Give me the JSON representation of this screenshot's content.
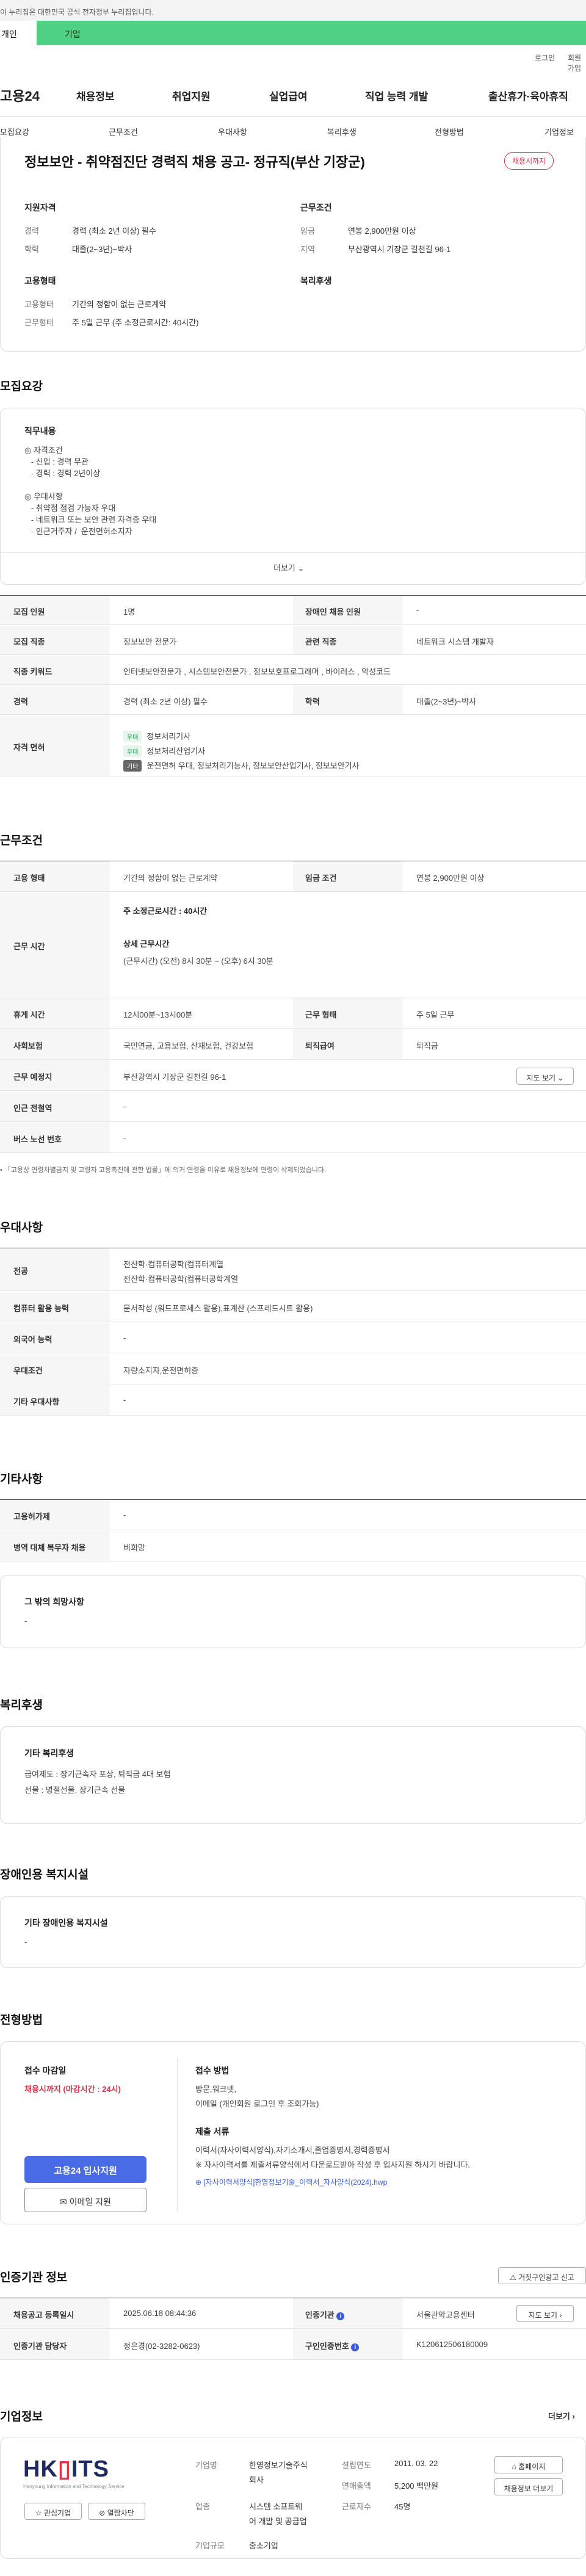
{
  "gov_strip": "이 누리집은 대한민국 공식 전자정부 누리집입니다.",
  "top_tabs": [
    "개인",
    "기업"
  ],
  "util_links": [
    "로그인",
    "회원가입"
  ],
  "gnb": {
    "logo": "고용24",
    "items": [
      "채용정보",
      "취업지원",
      "실업급여",
      "직업 능력 개발",
      "출산휴가·육아휴직"
    ]
  },
  "subnav": [
    "모집요강",
    "근무조건",
    "우대사항",
    "복리후생",
    "전형방법",
    "기업정보"
  ],
  "header": {
    "title": "정보보안 - 취약점진단 경력직 채용 공고- 정규직(부산 기장군)",
    "badge": "채용시까지",
    "qual_label": "지원자격",
    "cond_label": "근무조건",
    "career_k": "경력",
    "career_v": "경력 (최소 2년 이상) 필수",
    "edu_k": "학력",
    "edu_v": "대졸(2~3년)~박사",
    "wage_k": "임금",
    "wage_v": "연봉 2,900만원 이상",
    "area_k": "지역",
    "area_v": "부산광역시 기장군 길천길 96-1",
    "emp_label": "고용형태",
    "welfare_label": "복리후생",
    "emptype_k": "고용형태",
    "emptype_v": "기간의 정함이 없는 근로계약",
    "worktype_k": "근무형태",
    "worktype_v": "주 5일 근무 (주 소정근로시간: 40시간)"
  },
  "recruit": {
    "section_title": "모집요강",
    "duty_label": "직무내용",
    "duty_lines": [
      "◎ 자격조건",
      "   - 신입 : 경력 무관",
      "   - 경력 : 경력 2년이상",
      "",
      "◎ 우대사항",
      "   - 취약점 점검 가능자 우대",
      "   - 네트워크 또는 보안 관련 자격증 우대",
      "   - 인근거주자 /  운전면허소지자"
    ],
    "more": "더보기",
    "rows": {
      "occ_k": "모집 인원",
      "occ_v": "1명",
      "disabled_k": "장애인 채용 인원",
      "disabled_v": "-",
      "job_k": "모집 직종",
      "job_v": "정보보안 전문가",
      "rel_k": "관련 직종",
      "rel_v": "네트워크 시스템 개발자",
      "kw_k": "직종 키워드",
      "kw_v": "인터넷보안전문가 , 시스템보안전문가 , 정보보호프로그래머 , 바이러스 , 악성코드",
      "career_k": "경력",
      "career_v": "경력 (최소 2년 이상) 필수",
      "edu_k": "학력",
      "edu_v": "대졸(2~3년)~박사",
      "lic_k": "자격 면허",
      "licenses": [
        {
          "chip": "우대",
          "name": "정보처리기사"
        },
        {
          "chip": "우대",
          "name": "정보처리산업기사"
        },
        {
          "chip": "기타",
          "name": "운전면허 우대, 정보처리기능사, 정보보안산업기사, 정보보안기사"
        }
      ]
    }
  },
  "work": {
    "section_title": "근무조건",
    "emp_k": "고용 형태",
    "emp_v": "기간의 정함이 없는 근로계약",
    "wage_k": "임금 조건",
    "wage_v": "연봉 2,900만원 이상",
    "time_k": "근무 시간",
    "weekly": "주 소정근로시간 : 40시간",
    "detail_label": "상세 근무시간",
    "detail_v": "(근무시간) (오전) 8시 30분 ~ (오후) 6시 30분",
    "rest_k": "휴게 시간",
    "rest_v": "12시00분~13시00분",
    "shift_k": "근무 형태",
    "shift_v": "주 5일 근무",
    "ins_k": "사회보험",
    "ins_v": "국민연금, 고용보험, 산재보험, 건강보험",
    "ret_k": "퇴직급여",
    "ret_v": "퇴직금",
    "loc_k": "근무 예정지",
    "loc_v": "부산광역시 기장군 길천길 96-1",
    "map_btn": "지도 보기",
    "subway_k": "인근 전철역",
    "subway_v": "-",
    "bus_k": "버스 노선 번호",
    "bus_v": "-",
    "note": "「고용상 연령차별금지 및 고령자 고용촉진에 관한 법률」에 의거 연령을 이유로 채용정보에 연령이 삭제되었습니다."
  },
  "pref": {
    "section_title": "우대사항",
    "major_k": "전공",
    "major_v1": "전산학·컴퓨터공학(컴퓨터계열",
    "major_v2": "전산학·컴퓨터공학(컴퓨터공학계열",
    "pc_k": "컴퓨터 활용 능력",
    "pc_v": "문서작성 (워드프로세스 활용),표계산 (스프레드시트 활용)",
    "lang_k": "외국어 능력",
    "lang_v": "-",
    "cond_k": "우대조건",
    "cond_v": "자량소지자,운전면허증",
    "etc_k": "기타 우대사항",
    "etc_v": "-"
  },
  "etc": {
    "section_title": "기타사항",
    "disable_k": "고용허가제",
    "disable_v": "-",
    "mil_k": "병역 대체 복무자 채용",
    "mil_v": "비희망",
    "hope_label": "그 밖의 희망사항",
    "hope_v": "-"
  },
  "welfare": {
    "section_title": "복리후생",
    "label": "기타 복리후생",
    "line1": "급여제도 : 장기근속자 포상, 퇴직금 4대 보험",
    "line2": "선물 : 명절선물, 장기근속 선물"
  },
  "disabled_fac": {
    "section_title": "장애인용 복지시설",
    "label": "기타 장애인용 복지시설",
    "value": "-"
  },
  "apply": {
    "section_title": "전형방법",
    "deadline_label": "접수 마감일",
    "deadline_v": "채용시까지 (마감시간 : 24시)",
    "method_label": "접수 방법",
    "method_v1": "방문,워크넷,",
    "method_v2": "이메일 (개인회원 로그인 후 조회가능)",
    "docs_label": "제출 서류",
    "docs_v1": "이력서(자사이력서양식),자기소개서,졸업증명서,경력증명서",
    "docs_v2": "※ 자사이력서를 제출서류양식에서 다운로드받아 작성 후 입사지원 하시기 바랍니다.",
    "file": "[자사이력서양식]한영정보기술_이력서_자사양식(2024).hwp",
    "apply_btn": "고용24 입사지원",
    "email_btn": "이메일 지원"
  },
  "cert": {
    "section_title": "인증기관 정보",
    "report_btn": "거짓구인광고 신고",
    "reg_k": "채용공고 등록일시",
    "reg_v": "2025.06.18 08:44:36",
    "org_k": "인증기관",
    "org_v": "서울관악고용센터",
    "map_btn": "지도 보기",
    "mgr_k": "인증기관 담당자",
    "mgr_v": "정은경(02-3282-0623)",
    "no_k": "구인인증번호",
    "no_v": "K120612506180009"
  },
  "company": {
    "section_title": "기업정보",
    "more": "더보기",
    "logo_main": "HKITS",
    "logo_sub": "Hanyoung Information and Technology Service",
    "fav_btn": "관심기업",
    "block_btn": "열람차단",
    "name_k": "기업명",
    "name_v1": "한영정보기술주식",
    "name_v2": "회사",
    "biz_k": "업종",
    "biz_v1": "시스템 소프트웨",
    "biz_v2": "어 개발 및 공급업",
    "size_k": "기업규모",
    "size_v": "중소기업",
    "est_k": "설립연도",
    "est_v": "2011. 03. 22",
    "sales_k": "연매출액",
    "sales_v": "5,200 백만원",
    "emp_k": "근로자수",
    "emp_v": "45명",
    "home_btn": "홈페이지",
    "list_btn": "채용정보 더보기"
  }
}
